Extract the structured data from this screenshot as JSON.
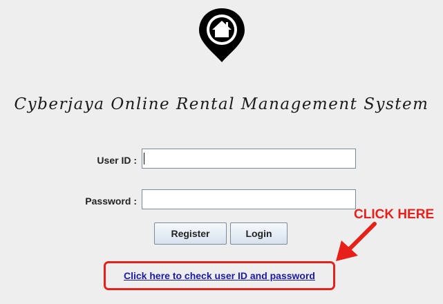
{
  "app": {
    "title": "Cyberjaya Online Rental Management System",
    "logo_icon": "home-location-pin-icon"
  },
  "form": {
    "user_id_label": "User ID :",
    "user_id_value": "",
    "password_label": "Password :",
    "password_value": ""
  },
  "buttons": {
    "register_label": "Register",
    "login_label": "Login"
  },
  "link": {
    "check_credentials_label": "Click here to check user ID and password"
  },
  "annotation": {
    "text": "CLICK HERE",
    "color": "#e8201a",
    "arrow_icon": "red-arrow-icon"
  }
}
